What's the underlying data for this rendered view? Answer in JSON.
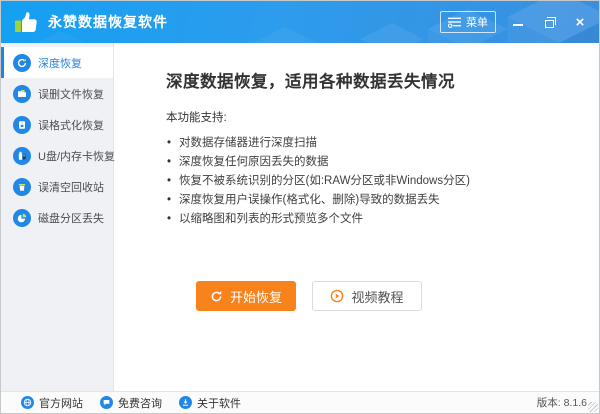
{
  "titlebar": {
    "title": "永赞数据恢复软件",
    "menu_label": "菜单",
    "logo_icon": "thumbs-up-icon",
    "window_controls": [
      "minimize",
      "restore",
      "close"
    ]
  },
  "sidebar": {
    "items": [
      {
        "label": "深度恢复",
        "icon": "deep-scan-refresh-icon",
        "selected": true
      },
      {
        "label": "误删文件恢复",
        "icon": "deleted-folder-icon",
        "selected": false
      },
      {
        "label": "误格式化恢复",
        "icon": "formatted-disk-icon",
        "selected": false
      },
      {
        "label": "U盘/内存卡恢复",
        "icon": "usb-memory-card-icon",
        "selected": false
      },
      {
        "label": "误清空回收站",
        "icon": "recycle-bin-icon",
        "selected": false
      },
      {
        "label": "磁盘分区丢失",
        "icon": "disk-partition-pie-icon",
        "selected": false
      }
    ]
  },
  "main": {
    "heading": "深度数据恢复，适用各种数据丢失情况",
    "support_label": "本功能支持:",
    "features": [
      "对数据存储器进行深度扫描",
      "深度恢复任何原因丢失的数据",
      "恢复不被系统识别的分区(如:RAW分区或非Windows分区)",
      "深度恢复用户误操作(格式化、删除)导致的数据丢失",
      "以缩略图和列表的形式预览多个文件"
    ],
    "start_button": "开始恢复",
    "video_button": "视频教程"
  },
  "footer": {
    "links": [
      {
        "label": "官方网站",
        "icon": "globe-icon"
      },
      {
        "label": "免费咨询",
        "icon": "chat-icon"
      },
      {
        "label": "关于软件",
        "icon": "about-download-icon"
      }
    ],
    "version": "版本: 8.1.6"
  },
  "colors": {
    "titlebar_blue_left": "#14a0f2",
    "titlebar_blue_right": "#3a8ede",
    "icon_blue": "#2188e8",
    "selected_blue": "#2a82dd",
    "accent_orange": "#f8821c",
    "lime_accent": "#bfe04e",
    "sidebar_bg": "#eff1f4"
  }
}
